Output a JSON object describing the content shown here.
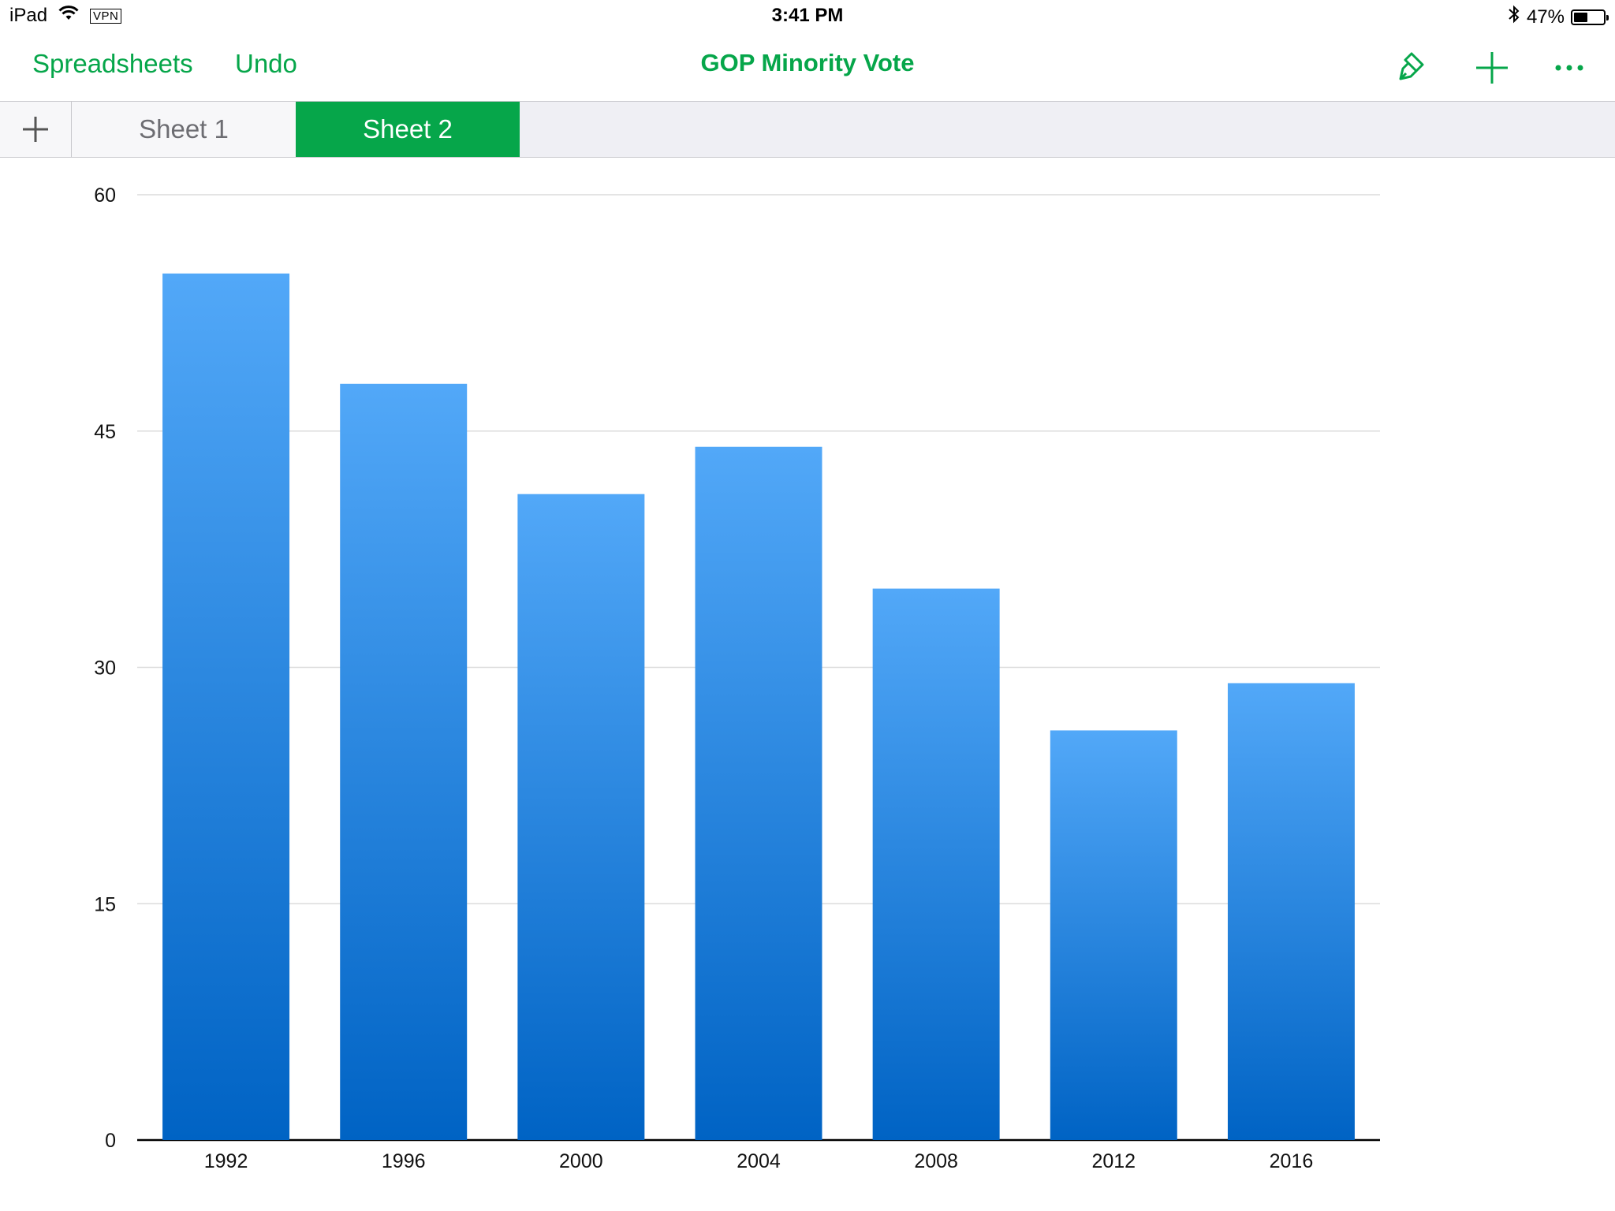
{
  "status_bar": {
    "device": "iPad",
    "vpn": "VPN",
    "time": "3:41 PM",
    "battery_percent": "47%",
    "battery_level": 0.47
  },
  "toolbar": {
    "back_label": "Spreadsheets",
    "undo_label": "Undo",
    "title": "GOP Minority Vote",
    "icons": [
      "paintbrush-icon",
      "plus-icon",
      "more-icon"
    ]
  },
  "tabs": {
    "items": [
      {
        "label": "Sheet 1",
        "active": false
      },
      {
        "label": "Sheet 2",
        "active": true
      }
    ]
  },
  "colors": {
    "accent": "#06a64a",
    "bar_top": "#52a8f8",
    "bar_bottom": "#0063c4"
  },
  "chart_data": {
    "type": "bar",
    "categories": [
      "1992",
      "1996",
      "2000",
      "2004",
      "2008",
      "2012",
      "2016"
    ],
    "values": [
      55,
      48,
      41,
      44,
      35,
      26,
      29
    ],
    "ylim": [
      0,
      60
    ],
    "yticks": [
      "0",
      "15",
      "30",
      "45",
      "60"
    ],
    "grid": true,
    "legend": "none"
  }
}
